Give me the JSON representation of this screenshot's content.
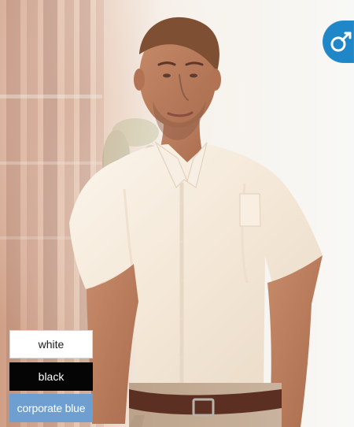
{
  "gender_badge": {
    "icon": "male-symbol-icon",
    "color": "#1f86c7"
  },
  "color_options": [
    {
      "label": "white",
      "color": "#ffffff"
    },
    {
      "label": "black",
      "color": "#050505"
    },
    {
      "label": "corporate blue",
      "color": "#6f9fd0"
    }
  ]
}
